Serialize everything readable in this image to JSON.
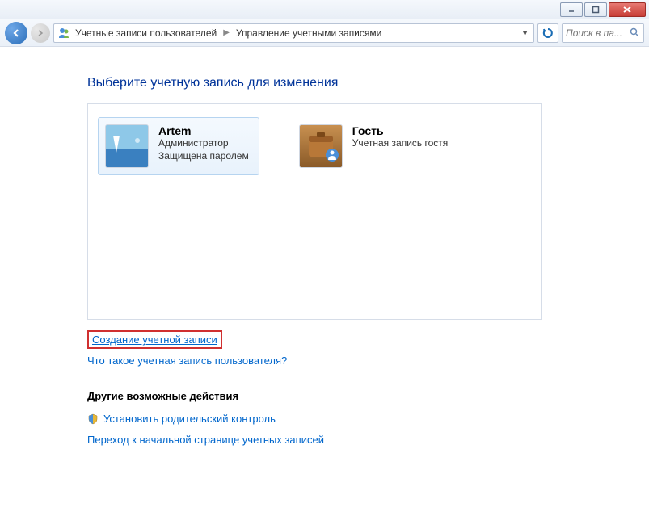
{
  "breadcrumb": {
    "level1": "Учетные записи пользователей",
    "level2": "Управление учетными записями"
  },
  "search": {
    "placeholder": "Поиск в па..."
  },
  "page_heading": "Выберите учетную запись для изменения",
  "accounts": [
    {
      "name": "Artem",
      "line1": "Администратор",
      "line2": "Защищена паролем"
    },
    {
      "name": "Гость",
      "line1": "Учетная запись гостя",
      "line2": ""
    }
  ],
  "links": {
    "create_account": "Создание учетной записи",
    "what_is_account": "Что такое учетная запись пользователя?",
    "other_actions_label": "Другие возможные действия",
    "parental_control": "Установить родительский контроль",
    "goto_home": "Переход к начальной странице учетных записей"
  }
}
